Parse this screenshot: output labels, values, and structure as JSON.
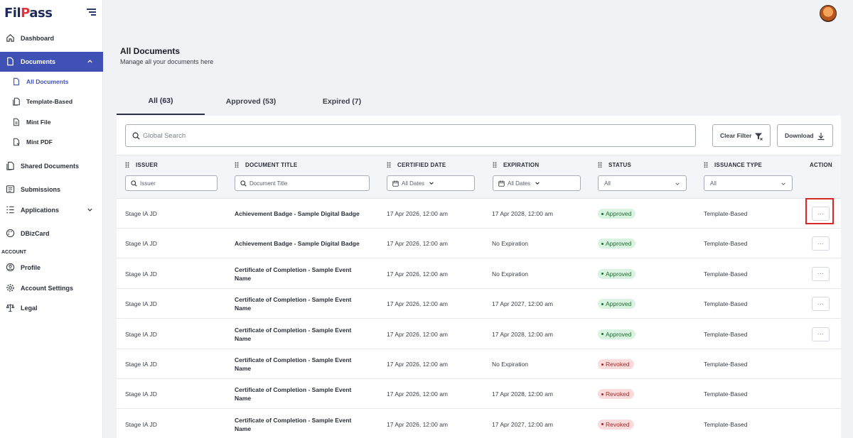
{
  "sidebar": {
    "logo": {
      "pre": "Fil",
      "mark": "P",
      "post": "ass"
    },
    "nav": [
      {
        "label": "Dashboard",
        "icon": "home-icon"
      },
      {
        "label": "Documents",
        "icon": "document-icon",
        "active": true
      },
      {
        "label": "Shared Documents",
        "icon": "shared-documents-icon"
      },
      {
        "label": "Submissions",
        "icon": "submissions-icon"
      },
      {
        "label": "Applications",
        "icon": "applications-icon"
      },
      {
        "label": "DBizCard",
        "icon": "palette-icon"
      },
      {
        "label": "Profile",
        "icon": "profile-icon"
      },
      {
        "label": "Account Settings",
        "icon": "gear-icon"
      },
      {
        "label": "Legal",
        "icon": "scales-icon"
      }
    ],
    "documents_sub": [
      {
        "label": "All Documents",
        "active": true
      },
      {
        "label": "Template-Based"
      },
      {
        "label": "Mint File"
      },
      {
        "label": "Mint PDF"
      }
    ],
    "section_account": "ACCOUNT"
  },
  "header": {
    "title": "All Documents",
    "subtitle": "Manage all your documents here"
  },
  "tabs": [
    {
      "label": "All (63)",
      "active": true
    },
    {
      "label": "Approved (53)"
    },
    {
      "label": "Expired (7)"
    }
  ],
  "toolbar": {
    "search_placeholder": "Global Search",
    "clear_filter": "Clear Filter",
    "download": "Download"
  },
  "table": {
    "columns": [
      "ISSUER",
      "DOCUMENT TITLE",
      "CERTIFIED DATE",
      "EXPIRATION",
      "STATUS",
      "ISSUANCE TYPE",
      "ACTION"
    ],
    "filters": {
      "issuer": "Issuer",
      "title": "Document Title",
      "certified": "All Dates",
      "expiration": "All Dates",
      "status": "All",
      "issuance": "All"
    },
    "rows": [
      {
        "issuer": "Stage IA JD",
        "title": "Achievement Badge - Sample Digital Badge",
        "certified": "17 Apr 2026, 12:00 am",
        "expiration": "17 Apr 2028, 12:00 am",
        "status": "Approved",
        "type": "Template-Based",
        "action": "···"
      },
      {
        "issuer": "Stage IA JD",
        "title": "Achievement Badge - Sample Digital Badge",
        "certified": "17 Apr 2026, 12:00 am",
        "expiration": "No Expiration",
        "status": "Approved",
        "type": "Template-Based",
        "action": "···"
      },
      {
        "issuer": "Stage IA JD",
        "title": "Certificate of Completion - Sample Event Name",
        "certified": "17 Apr 2026, 12:00 am",
        "expiration": "No Expiration",
        "status": "Approved",
        "type": "Template-Based",
        "action": "···"
      },
      {
        "issuer": "Stage IA JD",
        "title": "Certificate of Completion - Sample Event Name",
        "certified": "17 Apr 2026, 12:00 am",
        "expiration": "17 Apr 2027, 12:00 am",
        "status": "Approved",
        "type": "Template-Based",
        "action": "···"
      },
      {
        "issuer": "Stage IA JD",
        "title": "Certificate of Completion - Sample Event Name",
        "certified": "17 Apr 2026, 12:00 am",
        "expiration": "17 Apr 2028, 12:00 am",
        "status": "Approved",
        "type": "Template-Based",
        "action": "···"
      },
      {
        "issuer": "Stage IA JD",
        "title": "Certificate of Completion - Sample Event Name",
        "certified": "17 Apr 2026, 12:00 am",
        "expiration": "No Expiration",
        "status": "Revoked",
        "type": "Template-Based",
        "action": ""
      },
      {
        "issuer": "Stage IA JD",
        "title": "Certificate of Completion - Sample Event Name",
        "certified": "17 Apr 2026, 12:00 am",
        "expiration": "17 Apr 2028, 12:00 am",
        "status": "Revoked",
        "type": "Template-Based",
        "action": ""
      },
      {
        "issuer": "Stage IA JD",
        "title": "Certificate of Completion - Sample Event Name",
        "certified": "17 Apr 2026, 12:00 am",
        "expiration": "17 Apr 2027, 12:00 am",
        "status": "Revoked",
        "type": "Template-Based",
        "action": ""
      }
    ]
  },
  "colors": {
    "accent": "#3f51b5",
    "approved_bg": "#d8f3df",
    "revoked_bg": "#fbdcdc",
    "highlight": "#d62828"
  }
}
